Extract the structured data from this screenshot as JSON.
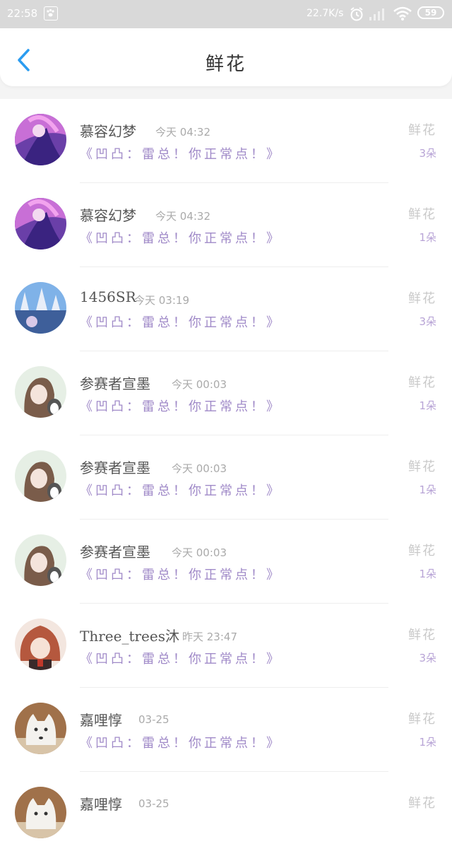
{
  "status_bar": {
    "time": "22:58",
    "speed": "22.7K/s",
    "battery": "59"
  },
  "header": {
    "title": "鲜花"
  },
  "rows": [
    {
      "name": "慕容幻梦",
      "time": "今天 04:32",
      "message": "《凹凸：雷总！你正常点！》",
      "kind": "鲜花",
      "count": "3朵",
      "avatar": "purple"
    },
    {
      "name": "慕容幻梦",
      "time": "今天 04:32",
      "message": "《凹凸：雷总！你正常点！》",
      "kind": "鲜花",
      "count": "1朵",
      "avatar": "purple"
    },
    {
      "name": "1456SR",
      "time": "今天 03:19",
      "message": "《凹凸：雷总！你正常点！》",
      "kind": "鲜花",
      "count": "3朵",
      "avatar": "blue"
    },
    {
      "name": "参赛者宣墨",
      "time": "今天 00:03",
      "message": "《凹凸：雷总！你正常点！》",
      "kind": "鲜花",
      "count": "1朵",
      "avatar": "green"
    },
    {
      "name": "参赛者宣墨",
      "time": "今天 00:03",
      "message": "《凹凸：雷总！你正常点！》",
      "kind": "鲜花",
      "count": "1朵",
      "avatar": "green"
    },
    {
      "name": "参赛者宣墨",
      "time": "今天 00:03",
      "message": "《凹凸：雷总！你正常点！》",
      "kind": "鲜花",
      "count": "1朵",
      "avatar": "green"
    },
    {
      "name": "Three_trees沐",
      "time": "昨天 23:47",
      "message": "《凹凸：雷总！你正常点！》",
      "kind": "鲜花",
      "count": "3朵",
      "avatar": "red"
    },
    {
      "name": "嘉哩惇",
      "time": "03-25",
      "message": "《凹凸：雷总！你正常点！》",
      "kind": "鲜花",
      "count": "1朵",
      "avatar": "wolf"
    },
    {
      "name": "嘉哩惇",
      "time": "03-25",
      "message": "",
      "kind": "鲜花",
      "count": "",
      "avatar": "wolf"
    }
  ],
  "colors": {
    "accent": "#2b9cf0",
    "message": "#a08ac8",
    "count": "#b8a4d6",
    "kind": "#c9c9c9"
  }
}
